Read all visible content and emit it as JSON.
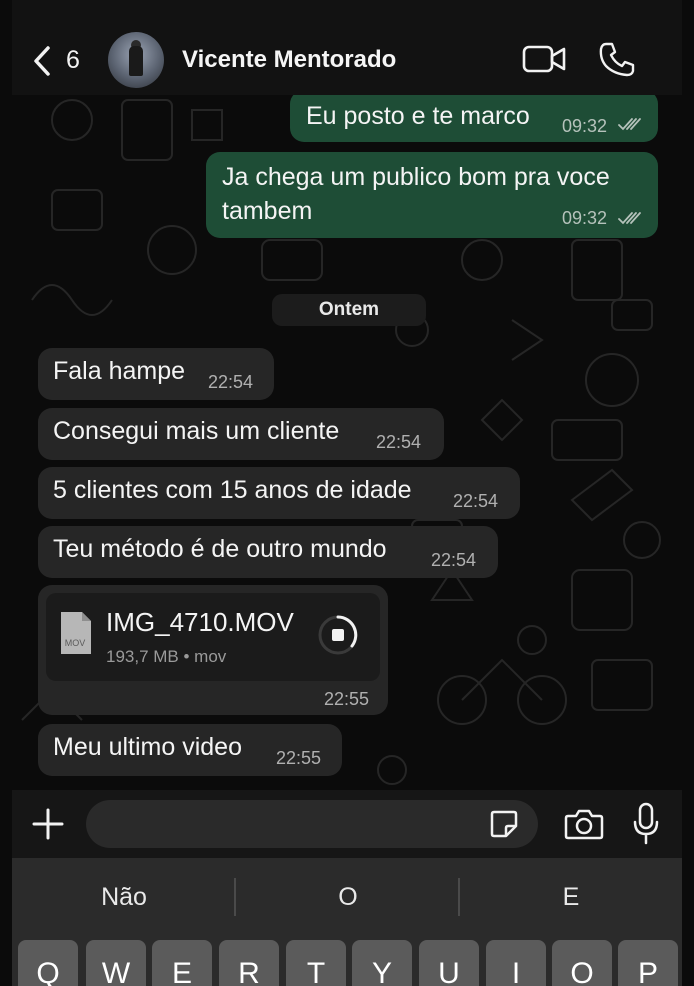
{
  "header": {
    "back_count": "6",
    "contact_name": "Vicente Mentorado"
  },
  "messages_out": [
    {
      "text": "Eu posto e te marco",
      "time": "09:32",
      "status": "read"
    },
    {
      "text_line1": "Ja chega um publico bom pra voce",
      "text_line2": "tambem",
      "time": "09:32",
      "status": "read"
    }
  ],
  "date_separator": "Ontem",
  "messages_in": [
    {
      "text": "Fala hampe",
      "time": "22:54"
    },
    {
      "text": "Consegui mais um cliente",
      "time": "22:54"
    },
    {
      "text": "5 clientes com 15 anos de idade",
      "time": "22:54"
    },
    {
      "text": "Teu método é de outro mundo",
      "time": "22:54"
    }
  ],
  "file_message": {
    "filename": "IMG_4710.MOV",
    "meta": "193,7 MB • mov",
    "icon_label": "MOV",
    "time": "22:55"
  },
  "last_message": {
    "text": "Meu ultimo video",
    "time": "22:55"
  },
  "input": {
    "placeholder": "",
    "value": ""
  },
  "keyboard": {
    "suggestions": [
      "Não",
      "O",
      "E"
    ],
    "row1": [
      "Q",
      "W",
      "E",
      "R",
      "T",
      "Y",
      "U",
      "I",
      "O",
      "P"
    ]
  },
  "colors": {
    "outgoing_bubble": "#1e4d36",
    "incoming_bubble": "#262626",
    "background": "#0b0b0b"
  }
}
